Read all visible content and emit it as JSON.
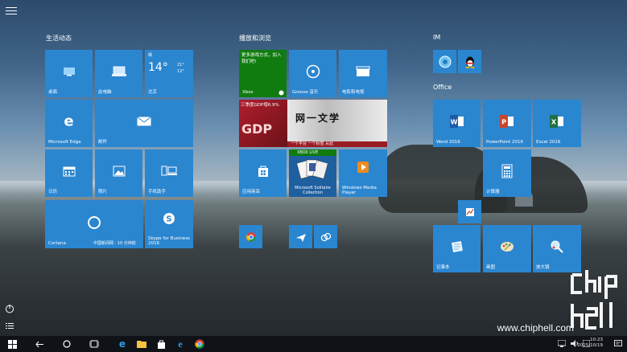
{
  "groups": {
    "life": "生活动态",
    "play": "播放和浏览",
    "im": "IM",
    "office": "Office"
  },
  "tiles": {
    "mail_desk": "桌面",
    "this_pc": "此电脑",
    "weather_city": "北京",
    "weather_day": "晴",
    "weather_temp": "14°",
    "weather_hi": "21°",
    "weather_lo": "12°",
    "edge": "Microsoft Edge",
    "mail": "邮件",
    "calendar": "日历",
    "photos": "照片",
    "phone": "手机助手",
    "cortana": "Cortana",
    "cortana_sub": "中国新闻网 · 10 分钟前",
    "skype": "Skype for Business 2016",
    "xbox_text": "更多游戏方式，加入我们吧!",
    "xbox": "Xbox",
    "groove": "Groove 音乐",
    "movies": "电影和电视",
    "news_title": "三季度GDP增6.9%",
    "news_text": "网一文学",
    "news_strip": "一个平台 一个标签 从此",
    "store": "应用商店",
    "xbox_live": "XBOX LIVE",
    "solitaire": "Microsoft Solitaire Collection",
    "wmp": "Windows Media Player",
    "word": "Word 2016",
    "powerpoint": "PowerPoint 2016",
    "excel": "Excel 2016",
    "calculator": "计算器",
    "notepad": "记事本",
    "paint": "画图",
    "magnifier": "放大镜"
  },
  "tray": {
    "time": "10:23",
    "date": "2015/10/19"
  },
  "watermark": "www.chiphell.com",
  "brand": "chip hell"
}
